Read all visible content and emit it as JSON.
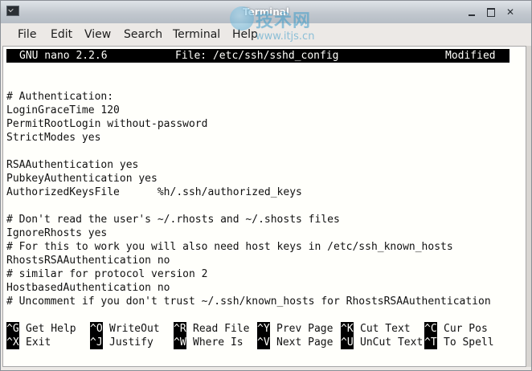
{
  "window": {
    "title": "Terminal"
  },
  "menu": [
    "File",
    "Edit",
    "View",
    "Search",
    "Terminal",
    "Help"
  ],
  "nano": {
    "version": "GNU nano 2.2.6",
    "file": "File: /etc/ssh/sshd_config",
    "status": "Modified"
  },
  "lines": [
    "",
    "",
    "# Authentication:",
    "LoginGraceTime 120",
    "PermitRootLogin without-password",
    "StrictModes yes",
    "",
    "RSAAuthentication yes",
    "PubkeyAuthentication yes",
    "AuthorizedKeysFile      %h/.ssh/authorized_keys",
    "",
    "# Don't read the user's ~/.rhosts and ~/.shosts files",
    "IgnoreRhosts yes",
    "# For this to work you will also need host keys in /etc/ssh_known_hosts",
    "RhostsRSAAuthentication no",
    "# similar for protocol version 2",
    "HostbasedAuthentication no",
    "# Uncomment if you don't trust ~/.ssh/known_hosts for RhostsRSAAuthentication"
  ],
  "shortcuts": [
    [
      {
        "key": "^G",
        "label": "Get Help"
      },
      {
        "key": "^O",
        "label": "WriteOut"
      },
      {
        "key": "^R",
        "label": "Read File"
      },
      {
        "key": "^Y",
        "label": "Prev Page"
      },
      {
        "key": "^K",
        "label": "Cut Text"
      },
      {
        "key": "^C",
        "label": "Cur Pos"
      }
    ],
    [
      {
        "key": "^X",
        "label": "Exit"
      },
      {
        "key": "^J",
        "label": "Justify"
      },
      {
        "key": "^W",
        "label": "Where Is"
      },
      {
        "key": "^V",
        "label": "Next Page"
      },
      {
        "key": "^U",
        "label": "UnCut Text"
      },
      {
        "key": "^T",
        "label": "To Spell"
      }
    ]
  ],
  "watermark": {
    "main": "技术网",
    "url": "www.itjs.cn"
  },
  "icons": {
    "app": "terminal-icon",
    "minimize": "minimize-icon",
    "maximize": "maximize-icon",
    "close": "close-icon"
  }
}
